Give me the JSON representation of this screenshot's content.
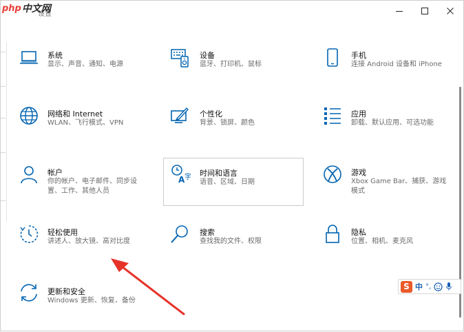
{
  "window": {
    "title": "设置",
    "watermark_php": "php",
    "watermark_cn": "中文网"
  },
  "accent_color": "#0063b1",
  "tiles": [
    {
      "id": "system",
      "icon": "laptop-icon",
      "title": "系统",
      "desc": "显示、声音、通知、电源"
    },
    {
      "id": "devices",
      "icon": "keyboard-speaker-icon",
      "title": "设备",
      "desc": "蓝牙、打印机、鼠标"
    },
    {
      "id": "phone",
      "icon": "phone-icon",
      "title": "手机",
      "desc": "连接 Android 设备和 iPhone"
    },
    {
      "id": "network",
      "icon": "globe-icon",
      "title": "网络和 Internet",
      "desc": "WLAN、飞行模式、VPN"
    },
    {
      "id": "personalization",
      "icon": "paint-brush-icon",
      "title": "个性化",
      "desc": "背景、锁屏、颜色"
    },
    {
      "id": "apps",
      "icon": "apps-list-icon",
      "title": "应用",
      "desc": "卸载、默认应用、可选功能"
    },
    {
      "id": "accounts",
      "icon": "person-icon",
      "title": "帐户",
      "desc": "你的帐户、电子邮件、同步设置、工作、其他人员"
    },
    {
      "id": "time-language",
      "icon": "time-language-icon",
      "title": "时间和语言",
      "desc": "语音、区域、日期"
    },
    {
      "id": "gaming",
      "icon": "xbox-icon",
      "title": "游戏",
      "desc": "Xbox Game Bar、捕获、游戏模式"
    },
    {
      "id": "ease-of-access",
      "icon": "ease-of-access-icon",
      "title": "轻松使用",
      "desc": "讲述人、放大镜、高对比度"
    },
    {
      "id": "search",
      "icon": "search-icon",
      "title": "搜索",
      "desc": "查找我的文件、权限"
    },
    {
      "id": "privacy",
      "icon": "lock-icon",
      "title": "隐私",
      "desc": "位置、相机、麦克风"
    },
    {
      "id": "update-security",
      "icon": "sync-icon",
      "title": "更新和安全",
      "desc": "Windows 更新、恢复、备份"
    }
  ],
  "ime": {
    "logo": "S",
    "lang": "中",
    "punct": "°,"
  }
}
